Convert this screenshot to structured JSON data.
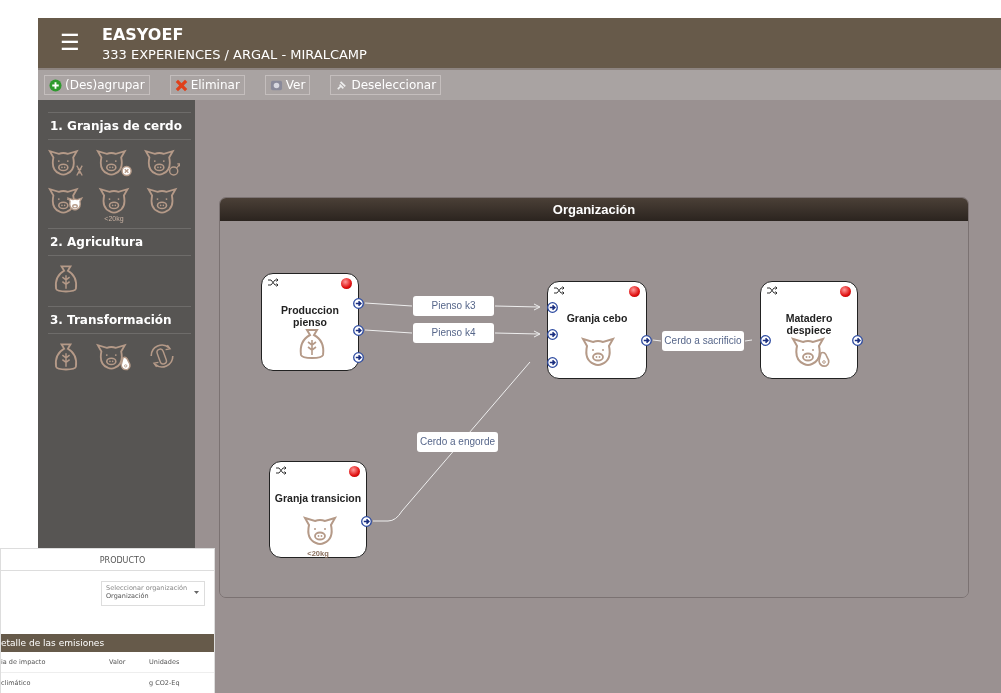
{
  "header": {
    "menu_icon": "☰",
    "title": "EASYOEF",
    "subtitle": "333 EXPERIENCES / ARGAL - MIRALCAMP"
  },
  "toolbar": [
    {
      "label": "(Des)agrupar",
      "kind": "plus"
    },
    {
      "label": "Eliminar",
      "kind": "cross"
    },
    {
      "label": "Ver",
      "kind": "view"
    },
    {
      "label": "Deseleccionar",
      "kind": "pin"
    }
  ],
  "sidebar": [
    {
      "title": "1. Granjas de cerdo",
      "items": [
        {
          "kind": "pig-dna"
        },
        {
          "kind": "pig-cross"
        },
        {
          "kind": "pig-male"
        },
        {
          "kind": "pig-two"
        },
        {
          "kind": "pig-small",
          "caption": "<20kg"
        },
        {
          "kind": "pig"
        }
      ]
    },
    {
      "title": "2. Agricultura",
      "items": [
        {
          "kind": "sack"
        }
      ]
    },
    {
      "title": "3. Transformación",
      "items": [
        {
          "kind": "sack"
        },
        {
          "kind": "pig-meat"
        },
        {
          "kind": "sausage"
        }
      ]
    }
  ],
  "panel": {
    "title": "Organización",
    "nodes": [
      {
        "name": "Produccion pienso",
        "kind": "sack"
      },
      {
        "name": "Granja cebo",
        "kind": "pig"
      },
      {
        "name": "Matadero despiece",
        "kind": "pig-meat"
      },
      {
        "name": "Granja transicion",
        "kind": "pig-small",
        "caption": "<20kg"
      }
    ],
    "edges": [
      {
        "label": "Pienso k3"
      },
      {
        "label": "Pienso k4"
      },
      {
        "label": "Cerdo a sacrificio"
      },
      {
        "label": "Cerdo a engorde"
      }
    ]
  },
  "inset": {
    "title": "PRODUCTO",
    "select": {
      "placeholder": "Seleccionar organización",
      "value": "Organización"
    },
    "section": "etalle de las emisiones",
    "columns": [
      "ia de impacto",
      "Valor",
      "Unidades"
    ],
    "rows": [
      [
        "climático",
        "",
        "g CO2-Eq"
      ]
    ]
  }
}
